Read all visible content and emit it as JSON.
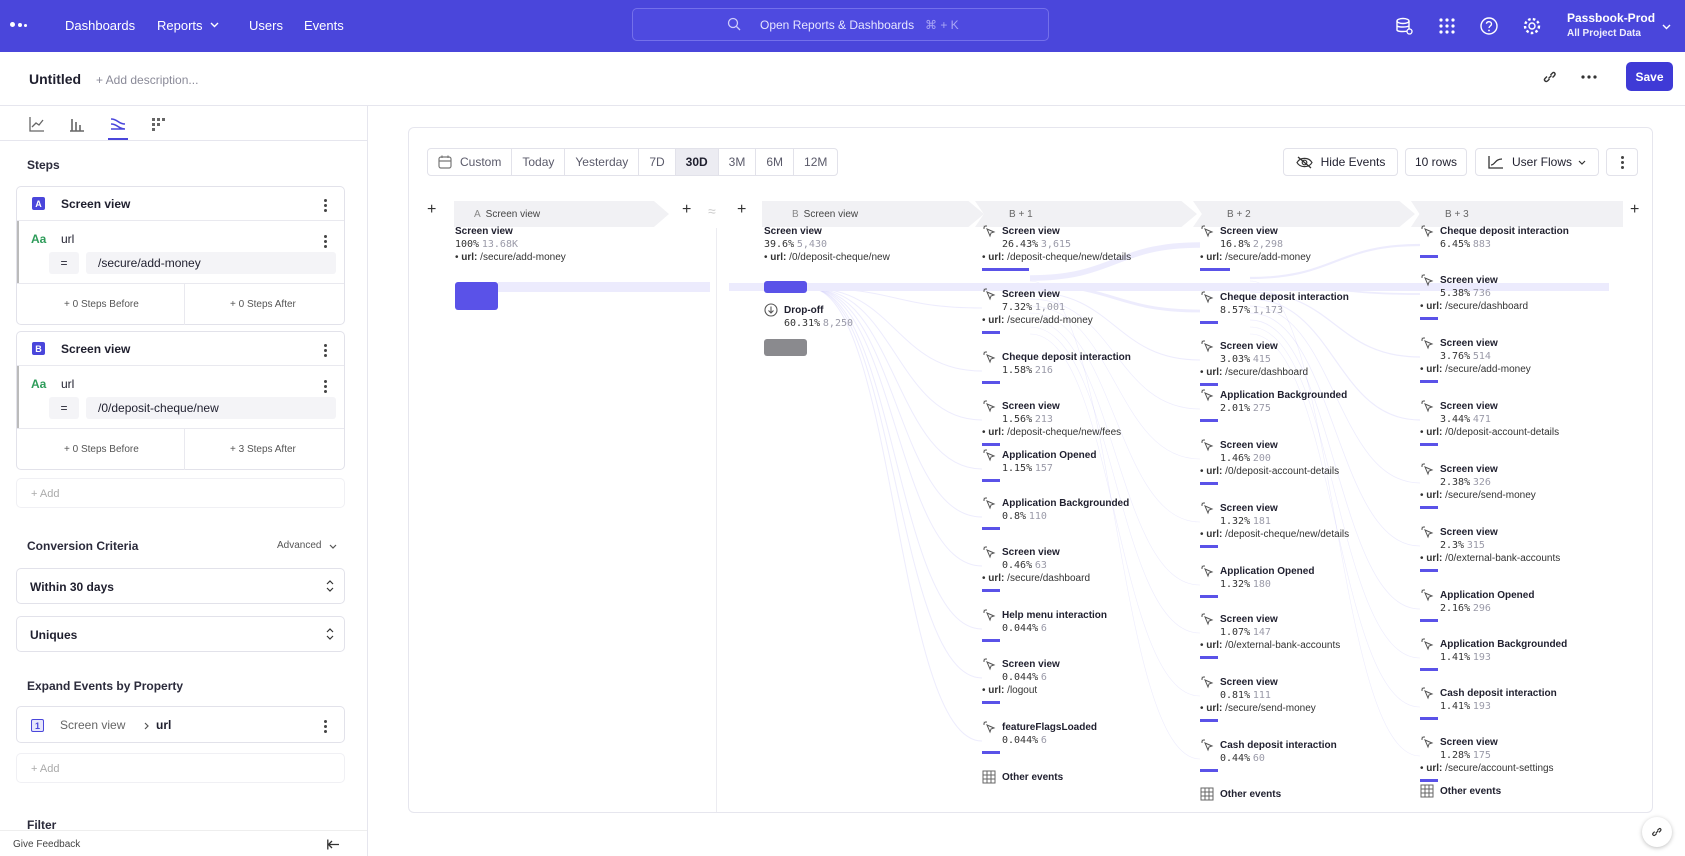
{
  "nav": {
    "items": [
      "Dashboards",
      "Reports",
      "Users",
      "Events"
    ],
    "search_text": "Open Reports & Dashboards",
    "search_shortcut": "⌘ + K",
    "project_name": "Passbook-Prod",
    "project_sub": "All Project Data"
  },
  "titlebar": {
    "title": "Untitled",
    "description": "+ Add description...",
    "save": "Save"
  },
  "left": {
    "steps_heading": "Steps",
    "step_a": {
      "badge": "A",
      "name": "Screen view",
      "filter_type": "Aa",
      "filter_prop": "url",
      "operator": "=",
      "value": "/secure/add-money",
      "before": "+ 0 Steps Before",
      "after": "+ 0 Steps After"
    },
    "step_b": {
      "badge": "B",
      "name": "Screen view",
      "filter_type": "Aa",
      "filter_prop": "url",
      "operator": "=",
      "value": "/0/deposit-cheque/new",
      "before": "+ 0 Steps Before",
      "after": "+ 3 Steps After"
    },
    "add": "+ Add",
    "conversion_heading": "Conversion Criteria",
    "advanced": "Advanced",
    "window": "Within 30 days",
    "counting": "Uniques",
    "expand_heading": "Expand Events by Property",
    "expand": {
      "badge": "1",
      "event": "Screen view",
      "property": "url"
    },
    "add2": "+ Add",
    "filter_heading": "Filter",
    "feedback": "Give Feedback"
  },
  "toolbar": {
    "ranges": [
      "Custom",
      "Today",
      "Yesterday",
      "7D",
      "30D",
      "3M",
      "6M",
      "12M"
    ],
    "active_range": "30D",
    "hide_events": "Hide Events",
    "rows": "10 rows",
    "view": "User Flows"
  },
  "columns": {
    "a": {
      "letter": "A",
      "label": "Screen view"
    },
    "b": {
      "letter": "B",
      "label": "Screen view"
    },
    "b1": "B + 1",
    "b2": "B + 2",
    "b3": "B + 3"
  },
  "col_a_nodes": [
    {
      "name": "Screen view",
      "pct": "100%",
      "count": "13.68K",
      "url": "/secure/add-money"
    }
  ],
  "col_b_nodes": [
    {
      "name": "Screen view",
      "pct": "39.6%",
      "count": "5,430",
      "url": "/0/deposit-cheque/new"
    },
    {
      "name": "Drop-off",
      "pct": "60.31%",
      "count": "8,250",
      "url": ""
    }
  ],
  "col_b1_nodes": [
    {
      "name": "Screen view",
      "pct": "26.43%",
      "count": "3,615",
      "url": "/deposit-cheque/new/details"
    },
    {
      "name": "Screen view",
      "pct": "7.32%",
      "count": "1,001",
      "url": "/secure/add-money"
    },
    {
      "name": "Cheque deposit interaction",
      "pct": "1.58%",
      "count": "216",
      "url": ""
    },
    {
      "name": "Screen view",
      "pct": "1.56%",
      "count": "213",
      "url": "/deposit-cheque/new/fees"
    },
    {
      "name": "Application Opened",
      "pct": "1.15%",
      "count": "157",
      "url": ""
    },
    {
      "name": "Application Backgrounded",
      "pct": "0.8%",
      "count": "110",
      "url": ""
    },
    {
      "name": "Screen view",
      "pct": "0.46%",
      "count": "63",
      "url": "/secure/dashboard"
    },
    {
      "name": "Help menu interaction",
      "pct": "0.044%",
      "count": "6",
      "url": ""
    },
    {
      "name": "Screen view",
      "pct": "0.044%",
      "count": "6",
      "url": "/logout"
    },
    {
      "name": "featureFlagsLoaded",
      "pct": "0.044%",
      "count": "6",
      "url": ""
    },
    {
      "name": "Other events",
      "pct": "",
      "count": "",
      "url": ""
    }
  ],
  "col_b2_nodes": [
    {
      "name": "Screen view",
      "pct": "16.8%",
      "count": "2,298",
      "url": "/secure/add-money"
    },
    {
      "name": "Cheque deposit interaction",
      "pct": "8.57%",
      "count": "1,173",
      "url": ""
    },
    {
      "name": "Screen view",
      "pct": "3.03%",
      "count": "415",
      "url": "/secure/dashboard"
    },
    {
      "name": "Application Backgrounded",
      "pct": "2.01%",
      "count": "275",
      "url": ""
    },
    {
      "name": "Screen view",
      "pct": "1.46%",
      "count": "200",
      "url": "/0/deposit-account-details"
    },
    {
      "name": "Screen view",
      "pct": "1.32%",
      "count": "181",
      "url": "/deposit-cheque/new/details"
    },
    {
      "name": "Application Opened",
      "pct": "1.32%",
      "count": "180",
      "url": ""
    },
    {
      "name": "Screen view",
      "pct": "1.07%",
      "count": "147",
      "url": "/0/external-bank-accounts"
    },
    {
      "name": "Screen view",
      "pct": "0.81%",
      "count": "111",
      "url": "/secure/send-money"
    },
    {
      "name": "Cash deposit interaction",
      "pct": "0.44%",
      "count": "60",
      "url": ""
    },
    {
      "name": "Other events",
      "pct": "",
      "count": "",
      "url": ""
    }
  ],
  "col_b3_nodes": [
    {
      "name": "Cheque deposit interaction",
      "pct": "6.45%",
      "count": "883",
      "url": ""
    },
    {
      "name": "Screen view",
      "pct": "5.38%",
      "count": "736",
      "url": "/secure/dashboard"
    },
    {
      "name": "Screen view",
      "pct": "3.76%",
      "count": "514",
      "url": "/secure/add-money"
    },
    {
      "name": "Screen view",
      "pct": "3.44%",
      "count": "471",
      "url": "/0/deposit-account-details"
    },
    {
      "name": "Screen view",
      "pct": "2.38%",
      "count": "326",
      "url": "/secure/send-money"
    },
    {
      "name": "Screen view",
      "pct": "2.3%",
      "count": "315",
      "url": "/0/external-bank-accounts"
    },
    {
      "name": "Application Opened",
      "pct": "2.16%",
      "count": "296",
      "url": ""
    },
    {
      "name": "Application Backgrounded",
      "pct": "1.41%",
      "count": "193",
      "url": ""
    },
    {
      "name": "Cash deposit interaction",
      "pct": "1.41%",
      "count": "193",
      "url": ""
    },
    {
      "name": "Screen view",
      "pct": "1.28%",
      "count": "175",
      "url": "/secure/account-settings"
    },
    {
      "name": "Other events",
      "pct": "",
      "count": "",
      "url": ""
    }
  ],
  "url_label": "url:",
  "colors": {
    "brand": "#4a46db",
    "bar": "#5a52e8",
    "dropoff": "#8a8a8e"
  }
}
